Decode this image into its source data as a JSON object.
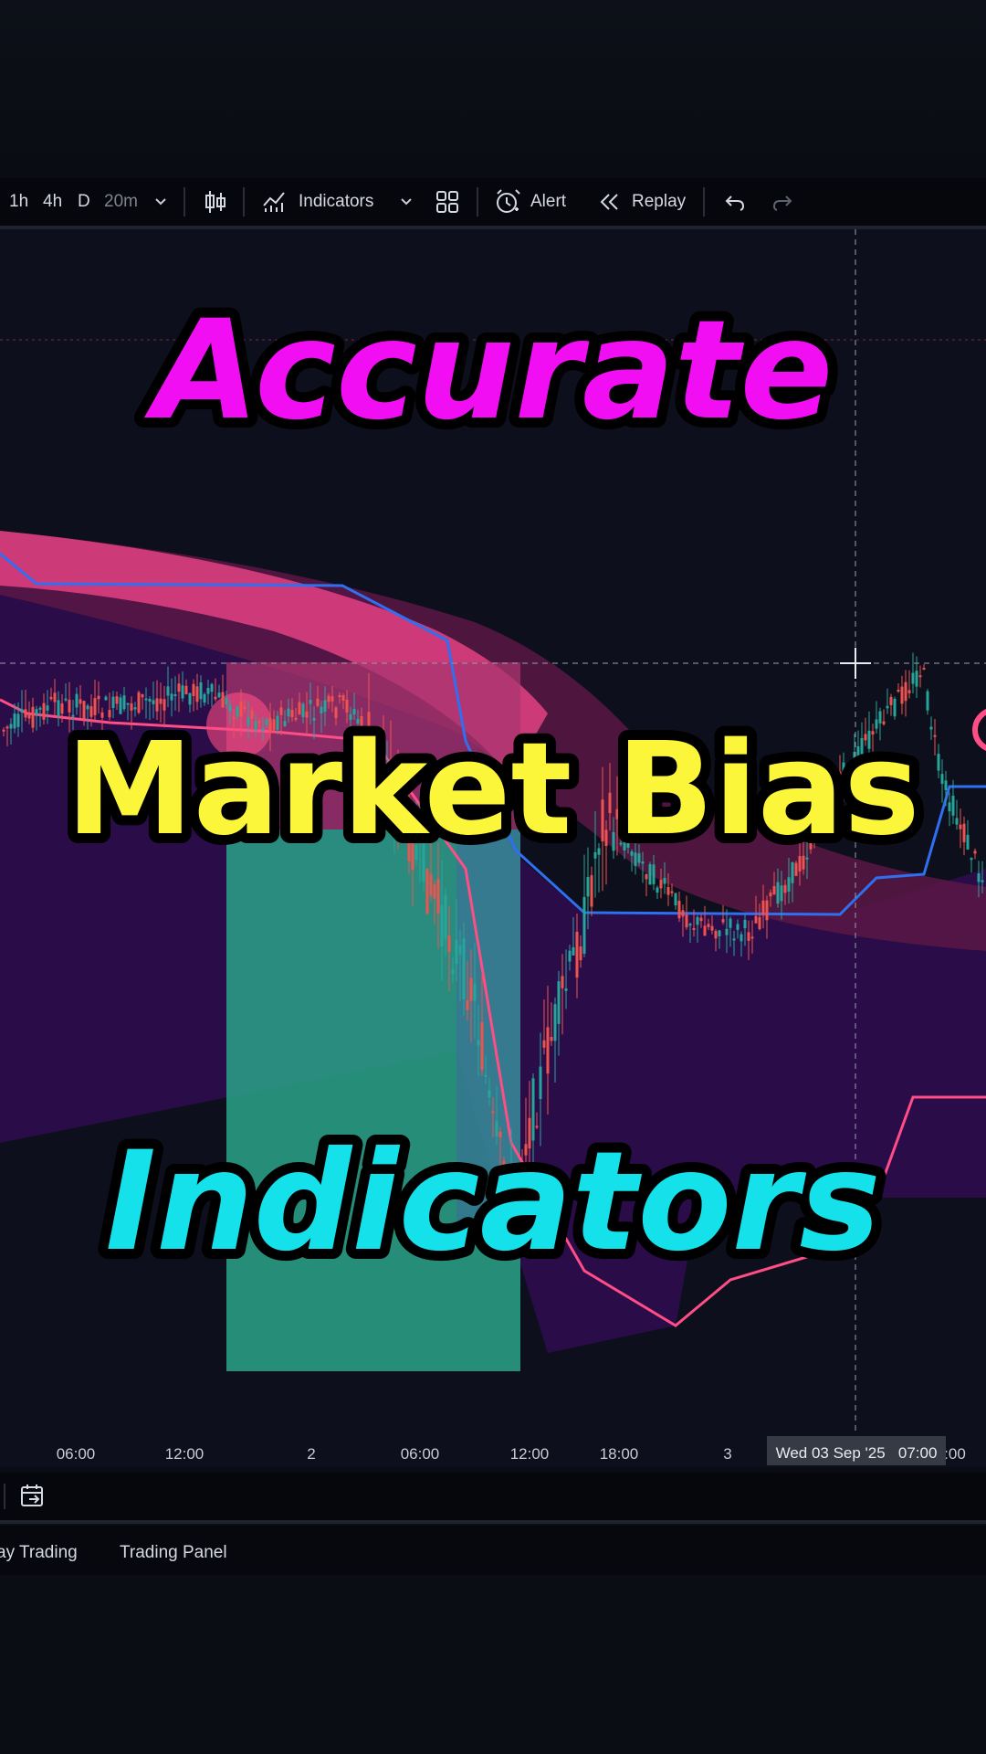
{
  "toolbar": {
    "timeframes": [
      "1h",
      "4h",
      "D"
    ],
    "active_timeframe": "20m",
    "indicators_label": "Indicators",
    "alert_label": "Alert",
    "replay_label": "Replay"
  },
  "overlay": {
    "line1": "Accurate",
    "line2": "Market Bias",
    "line3": "Indicators",
    "line1_color": "#f20ef2",
    "line2_color": "#fcf63a",
    "line3_color": "#14e1ea"
  },
  "chart": {
    "time_labels": [
      "06:00",
      "12:00",
      "2",
      "06:00",
      "12:00",
      "18:00",
      "3"
    ],
    "last_label": ":00",
    "crosshair_time": "Wed 03 Sep '25   07:00",
    "colors": {
      "up_candle": "#26a69a",
      "down_candle": "#ef5350",
      "blue_band": "#2f6ff0",
      "pink_band": "#ff4d86",
      "cloud": "#3a0f5a"
    }
  },
  "bottom_tabs": [
    "ay Trading",
    "Trading Panel"
  ]
}
